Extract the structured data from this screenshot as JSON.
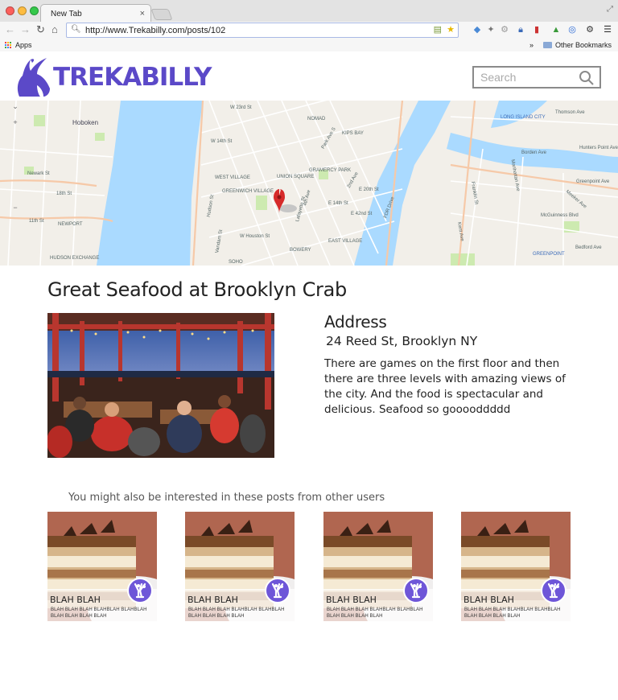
{
  "browser": {
    "tab_title": "New Tab",
    "tab_close": "×",
    "url": "http://www.Trekabilly.com/posts/102",
    "bookmarks_apps": "Apps",
    "bookmarks_overflow": "»",
    "bookmarks_other": "Other Bookmarks"
  },
  "site": {
    "logo_text": "TREKABILLY",
    "search_placeholder": "Search",
    "accent": "#5b49c8"
  },
  "map": {
    "labels": [
      "Hoboken",
      "NOMAD",
      "KIPS BAY",
      "LONG ISLAND CITY",
      "UNION SQUARE",
      "GRAMERCY PARK",
      "WEST VILLAGE",
      "GREENWICH VILLAGE",
      "EAST VILLAGE",
      "BOWERY",
      "SOHO",
      "NEWPORT",
      "HUDSON EXCHANGE",
      "GREENPOINT",
      "W 23rd St",
      "W 14th St",
      "E 14th St",
      "E 20th St",
      "Borden Ave",
      "Thomson Ave",
      "Hunters Point Ave",
      "Greenpoint Ave",
      "Newark St",
      "18th St",
      "11th St",
      "Manhattan Ave",
      "Franklin St",
      "Kent Ave",
      "McGuinness Blvd",
      "Meeker Ave",
      "Bedford Ave",
      "Vandam St",
      "Hudson St",
      "Lafayette St",
      "4th Ave",
      "Park Ave S",
      "2nd Ave",
      "FDR Drive",
      "W Houston St",
      "E 42nd St"
    ]
  },
  "post": {
    "title": "Great Seafood at Brooklyn Crab",
    "address_heading": "Address",
    "address": "24 Reed St, Brooklyn NY",
    "description": "There are games on the first floor and then there are three levels with amazing views of the city. And the food is spectacular and delicious. Seafood so gooooddddd"
  },
  "related": {
    "heading": "You might also be interested in these posts from other users",
    "cards": [
      {
        "title": "BLAH BLAH",
        "text": "BLAH BLAH BLAH BLAHBLAH BLAHBLAH BLAH BLAH BLAH BLAH"
      },
      {
        "title": "BLAH BLAH",
        "text": "BLAH BLAH BLAH BLAHBLAH BLAHBLAH BLAH BLAH BLAH BLAH"
      },
      {
        "title": "BLAH BLAH",
        "text": "BLAH BLAH BLAH BLAHBLAH BLAHBLAH BLAH BLAH BLAH BLAH"
      },
      {
        "title": "BLAH BLAH",
        "text": "BLAH BLAH BLAH BLAHBLAH BLAHBLAH BLAH BLAH BLAH BLAH"
      }
    ],
    "badge_color": "#6e56d8"
  }
}
